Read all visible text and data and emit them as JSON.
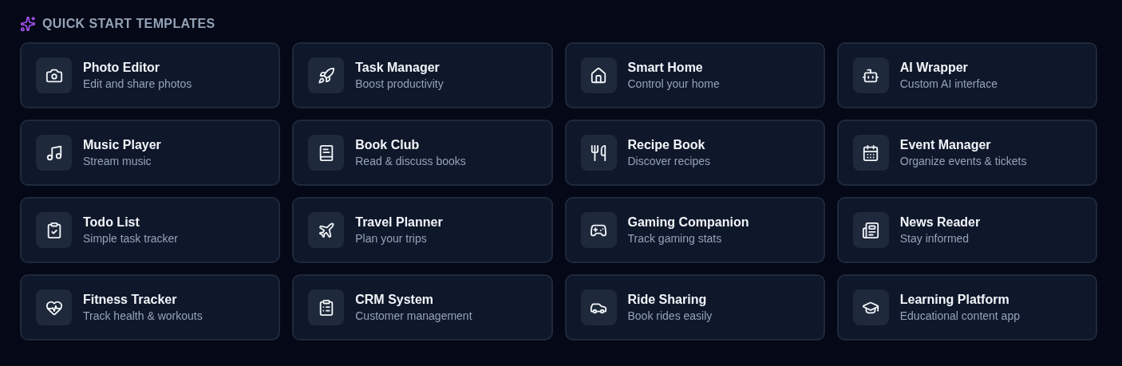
{
  "section": {
    "title": "QUICK START TEMPLATES"
  },
  "templates": [
    {
      "title": "Photo Editor",
      "subtitle": "Edit and share photos"
    },
    {
      "title": "Task Manager",
      "subtitle": "Boost productivity"
    },
    {
      "title": "Smart Home",
      "subtitle": "Control your home"
    },
    {
      "title": "AI Wrapper",
      "subtitle": "Custom AI interface"
    },
    {
      "title": "Music Player",
      "subtitle": "Stream music"
    },
    {
      "title": "Book Club",
      "subtitle": "Read & discuss books"
    },
    {
      "title": "Recipe Book",
      "subtitle": "Discover recipes"
    },
    {
      "title": "Event Manager",
      "subtitle": "Organize events & tickets"
    },
    {
      "title": "Todo List",
      "subtitle": "Simple task tracker"
    },
    {
      "title": "Travel Planner",
      "subtitle": "Plan your trips"
    },
    {
      "title": "Gaming Companion",
      "subtitle": "Track gaming stats"
    },
    {
      "title": "News Reader",
      "subtitle": "Stay informed"
    },
    {
      "title": "Fitness Tracker",
      "subtitle": "Track health & workouts"
    },
    {
      "title": "CRM System",
      "subtitle": "Customer management"
    },
    {
      "title": "Ride Sharing",
      "subtitle": "Book rides easily"
    },
    {
      "title": "Learning Platform",
      "subtitle": "Educational content app"
    }
  ]
}
